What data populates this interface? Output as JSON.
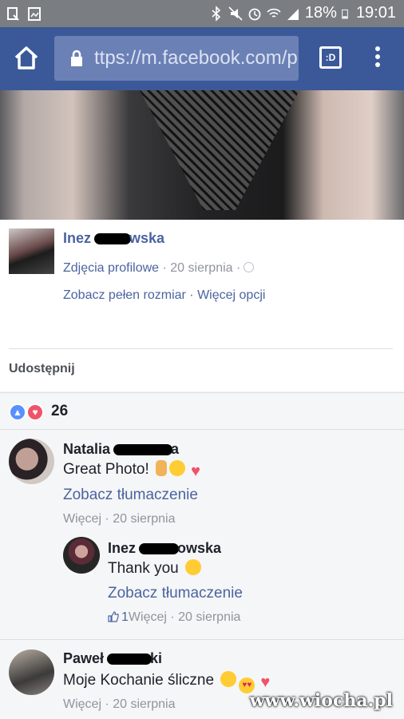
{
  "status_bar": {
    "battery": "18%",
    "time": "19:01"
  },
  "browser": {
    "url": "ttps://m.facebook.com/p",
    "tabs_label": ":D"
  },
  "post": {
    "author": "Inez",
    "author_suffix": "wska",
    "album": "Zdjęcia profilowe",
    "date": "20 sierpnia",
    "view_full": "Zobacz pełen rozmiar",
    "more_options": "Więcej opcji",
    "share_label": "Udostępnij"
  },
  "reactions": {
    "count": "26"
  },
  "comments": [
    {
      "name": "Natalia",
      "name_suffix": "a",
      "text": "Great Photo!",
      "translate": "Zobacz tłumaczenie",
      "more": "Więcej",
      "date": "20 sierpnia"
    },
    {
      "name": "Inez",
      "name_suffix": "owska",
      "text": "Thank you",
      "translate": "Zobacz tłumaczenie",
      "likes": "1",
      "more": "Więcej",
      "date": "20 sierpnia"
    },
    {
      "name": "Paweł",
      "name_suffix": "ki",
      "text": "Moje Kochanie śliczne",
      "more": "Więcej",
      "date": "20 sierpnia"
    }
  ],
  "watermark": "www.wiocha.pl",
  "colors": {
    "facebook_blue": "#3b5998",
    "link": "#4b64a0",
    "meta": "#90949c"
  }
}
